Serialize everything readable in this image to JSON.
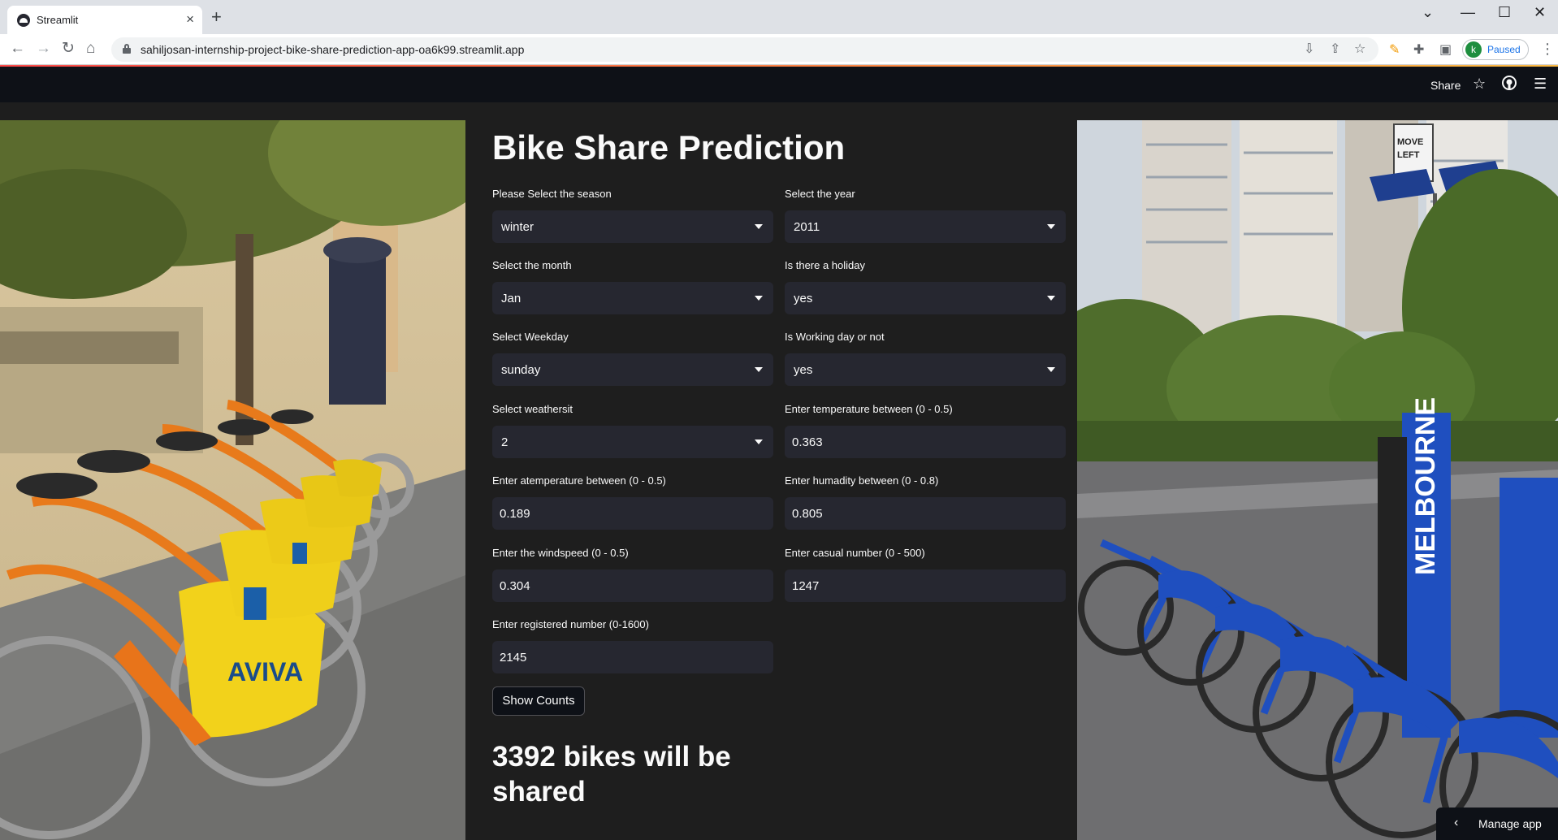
{
  "browser": {
    "tab_title": "Streamlit",
    "tab_close": "×",
    "new_tab": "+",
    "url": "sahiljosan-internship-project-bike-share-prediction-app-oa6k99.streamlit.app",
    "profile_initial": "k",
    "profile_status": "Paused",
    "nav_icons": [
      "back-icon",
      "forward-icon",
      "reload-icon",
      "home-icon"
    ],
    "window_controls": [
      "chevron-down-icon",
      "minimize-icon",
      "maximize-icon",
      "close-icon"
    ]
  },
  "header": {
    "share_label": "Share",
    "icons": [
      "star-icon",
      "github-icon",
      "menu-icon"
    ]
  },
  "app": {
    "title": "Bike Share Prediction",
    "fields": {
      "season": {
        "label": "Please Select the season",
        "value": "winter"
      },
      "year": {
        "label": "Select the year",
        "value": "2011"
      },
      "month": {
        "label": "Select the month",
        "value": "Jan"
      },
      "holiday": {
        "label": "Is there a holiday",
        "value": "yes"
      },
      "weekday": {
        "label": "Select Weekday",
        "value": "sunday"
      },
      "workingday": {
        "label": "Is Working day or not",
        "value": "yes"
      },
      "weathersit": {
        "label": "Select weathersit",
        "value": "2"
      },
      "temp": {
        "label": "Enter temperature between (0 - 0.5)",
        "value": "0.363"
      },
      "atemp": {
        "label": "Enter atemperature between (0 - 0.5)",
        "value": "0.189"
      },
      "humidity": {
        "label": "Enter humadity between (0 - 0.8)",
        "value": "0.805"
      },
      "windspeed": {
        "label": "Enter the windspeed (0 - 0.5)",
        "value": "0.304"
      },
      "casual": {
        "label": "Enter casual number (0 - 500)",
        "value": "1247"
      },
      "registered": {
        "label": "Enter registered number (0-1600)",
        "value": "2145"
      }
    },
    "button_label": "Show Counts",
    "result_line1": "3392 bikes will be",
    "result_line2": "shared",
    "image_text": {
      "left_sign": "AVIVA",
      "right_sign": "MOVE LEFT",
      "right_station": "MELBOURNE"
    }
  },
  "footer": {
    "manage_app_label": "Manage app"
  },
  "colors": {
    "app_bg": "#1e1e1e",
    "header_bg": "#0e1117",
    "widget_bg": "#262730",
    "text": "#fafafa"
  }
}
